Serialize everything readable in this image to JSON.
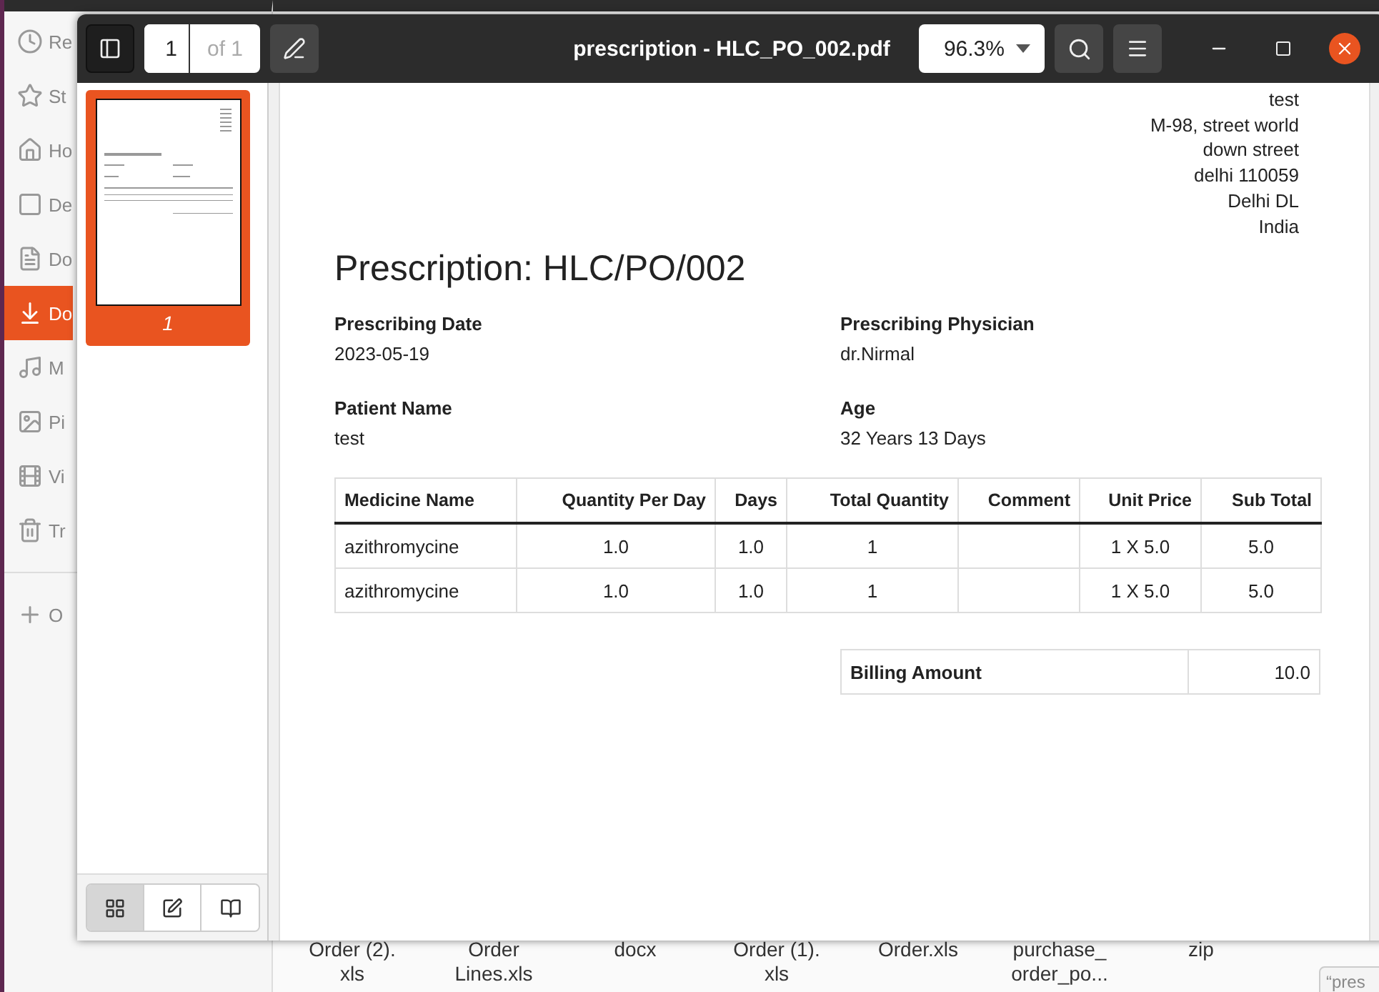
{
  "file_manager": {
    "sidebar_items": [
      {
        "label": "Re",
        "selected": false
      },
      {
        "label": "St",
        "selected": false
      },
      {
        "label": "Ho",
        "selected": false
      },
      {
        "label": "De",
        "selected": false
      },
      {
        "label": "Do",
        "selected": false
      },
      {
        "label": "Do",
        "selected": true
      },
      {
        "label": "M",
        "selected": false
      },
      {
        "label": "Pi",
        "selected": false
      },
      {
        "label": "Vi",
        "selected": false
      },
      {
        "label": "Tr",
        "selected": false
      }
    ],
    "other_locations": "O",
    "files": [
      "Order (2).\nxls",
      "Order\nLines.xls",
      "docx",
      "Order (1).\nxls",
      "Order.xls",
      "purchase_\norder_po...",
      "zip"
    ],
    "tooltip": "“pres"
  },
  "viewer": {
    "title": "prescription - HLC_PO_002.pdf",
    "page_number": "1",
    "page_count": "of 1",
    "zoom": "96.3%",
    "thumbnails": [
      {
        "label": "1",
        "selected": true
      }
    ],
    "sidebar_modes": [
      {
        "kind": "thumbnails",
        "selected": true
      },
      {
        "kind": "annotations",
        "selected": false
      },
      {
        "kind": "bookmarks",
        "selected": false
      }
    ]
  },
  "document": {
    "address": [
      "test",
      "M-98, street world",
      "down street",
      "delhi 110059",
      "Delhi DL",
      "India"
    ],
    "title": "Prescription: HLC/PO/002",
    "fields": [
      {
        "label": "Prescribing Date",
        "value": "2023-05-19"
      },
      {
        "label": "Prescribing Physician",
        "value": "dr.Nirmal"
      },
      {
        "label": "Patient Name",
        "value": "test"
      },
      {
        "label": "Age",
        "value": "32 Years 13 Days"
      }
    ],
    "table": {
      "columns": [
        "Medicine Name",
        "Quantity Per Day",
        "Days",
        "Total Quantity",
        "Comment",
        "Unit Price",
        "Sub Total"
      ],
      "rows": [
        [
          "azithromycine",
          "1.0",
          "1.0",
          "1",
          "",
          "1 X 5.0",
          "5.0"
        ],
        [
          "azithromycine",
          "1.0",
          "1.0",
          "1",
          "",
          "1 X 5.0",
          "5.0"
        ]
      ]
    },
    "billing": {
      "label": "Billing Amount",
      "value": "10.0"
    }
  }
}
